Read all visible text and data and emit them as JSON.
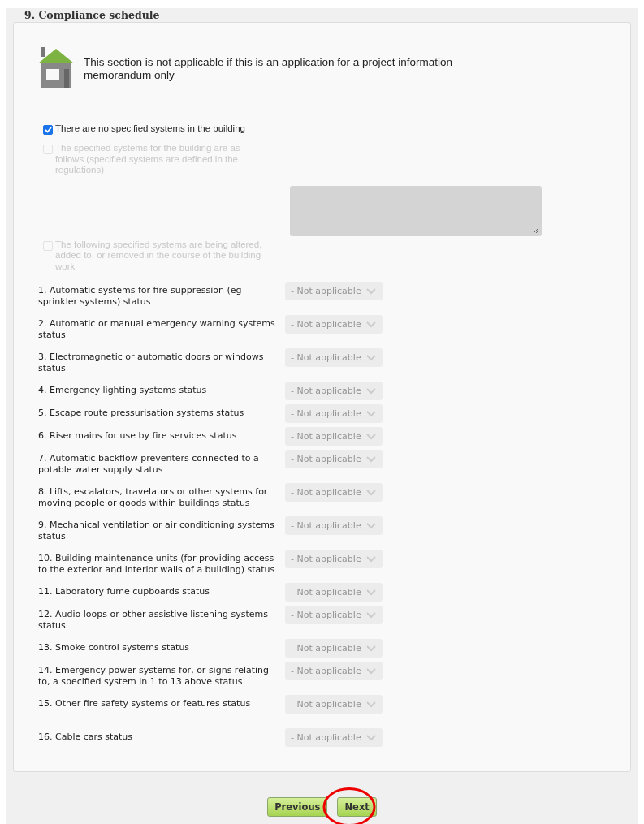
{
  "section": {
    "title": "9. Compliance schedule",
    "notice": "This section is not applicable if this is an application for a project information memorandum only"
  },
  "options": [
    {
      "label": "There are no specified systems in the building",
      "checked": true,
      "disabled": false
    },
    {
      "label": "The specified systems for the building are as follows (specified systems are defined in the regulations)",
      "checked": false,
      "disabled": true,
      "kind": "textarea"
    },
    {
      "label": "The following specified systems are being altered, added to, or removed in the course of the building work",
      "checked": false,
      "disabled": true
    }
  ],
  "systems": [
    {
      "label": "1. Automatic systems for fire suppression (eg sprinkler systems) status",
      "value": "- Not applicable",
      "disabled": true
    },
    {
      "label": "2. Automatic or manual emergency warning systems status",
      "value": "- Not applicable",
      "disabled": true
    },
    {
      "label": "3. Electromagnetic or automatic doors or windows status",
      "value": "- Not applicable",
      "disabled": true
    },
    {
      "label": "4. Emergency lighting systems status",
      "value": "- Not applicable",
      "disabled": true
    },
    {
      "label": "5. Escape route pressurisation systems status",
      "value": "- Not applicable",
      "disabled": true
    },
    {
      "label": "6. Riser mains for use by fire services status",
      "value": "- Not applicable",
      "disabled": true
    },
    {
      "label": "7. Automatic backflow preventers connected to a potable water supply status",
      "value": "- Not applicable",
      "disabled": true
    },
    {
      "label": "8. Lifts, escalators, travelators or other systems for moving people or goods within buildings status",
      "value": "- Not applicable",
      "disabled": true
    },
    {
      "label": "9. Mechanical ventilation or air conditioning systems status",
      "value": "- Not applicable",
      "disabled": true
    },
    {
      "label": "10. Building maintenance units (for providing access to the exterior and interior walls of a building) status",
      "value": "- Not applicable",
      "disabled": true
    },
    {
      "label": "11. Laboratory fume cupboards status",
      "value": "- Not applicable",
      "disabled": true
    },
    {
      "label": "12. Audio loops or other assistive listening systems status",
      "value": "- Not applicable",
      "disabled": true
    },
    {
      "label": "13. Smoke control systems status",
      "value": "- Not applicable",
      "disabled": true
    },
    {
      "label": "14. Emergency power systems for, or signs relating to, a specified system in 1 to 13 above status",
      "value": "- Not applicable",
      "disabled": true
    },
    {
      "label": "15. Other fire safety systems or features status",
      "value": "- Not applicable",
      "disabled": true
    },
    {
      "label": "16. Cable cars status",
      "value": "- Not applicable",
      "disabled": true
    }
  ],
  "buttons": [
    {
      "label": "Previous",
      "highlighted": false
    },
    {
      "label": "Next",
      "highlighted": true
    }
  ]
}
